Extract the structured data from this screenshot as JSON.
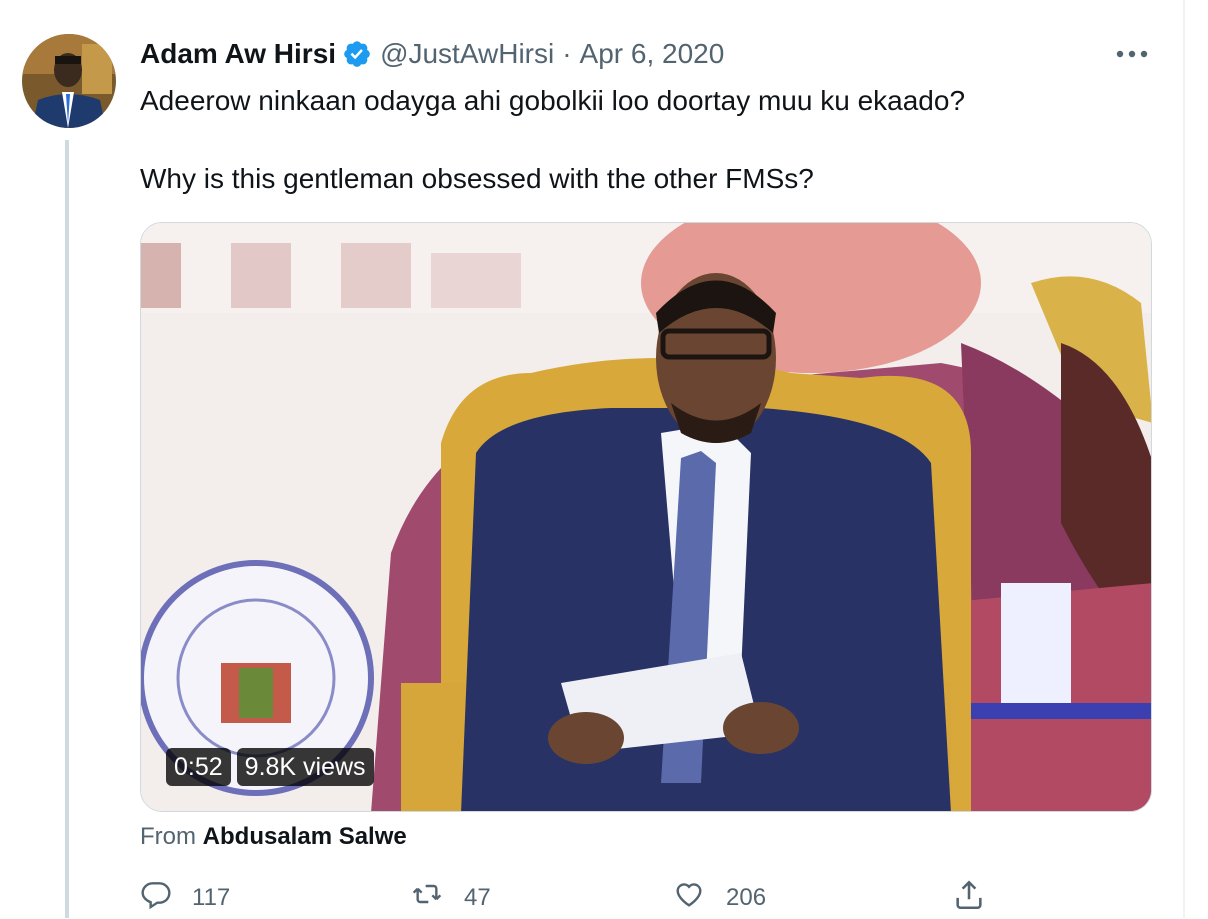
{
  "tweet": {
    "author_name": "Adam Aw Hirsi",
    "handle": "@JustAwHirsi",
    "separator": "·",
    "date": "Apr 6, 2020",
    "text_line1": "Adeerow ninkaan odayga ahi gobolkii loo doortay muu ku ekaado?",
    "text_line2": "Why is this gentleman obsessed with the other FMSs?"
  },
  "video": {
    "duration": "0:52",
    "views": "9.8K views"
  },
  "attribution": {
    "prefix": "From",
    "source": "Abdusalam Salwe"
  },
  "actions": {
    "replies": "117",
    "retweets": "47",
    "likes": "206"
  },
  "icons": {
    "verified": "verified-badge-icon",
    "more": "more-dots-icon",
    "reply": "reply-icon",
    "retweet": "retweet-icon",
    "like": "heart-icon",
    "share": "share-icon"
  },
  "colors": {
    "accent": "#1d9bf0",
    "secondary_text": "#536471",
    "primary_text": "#0f1419"
  }
}
